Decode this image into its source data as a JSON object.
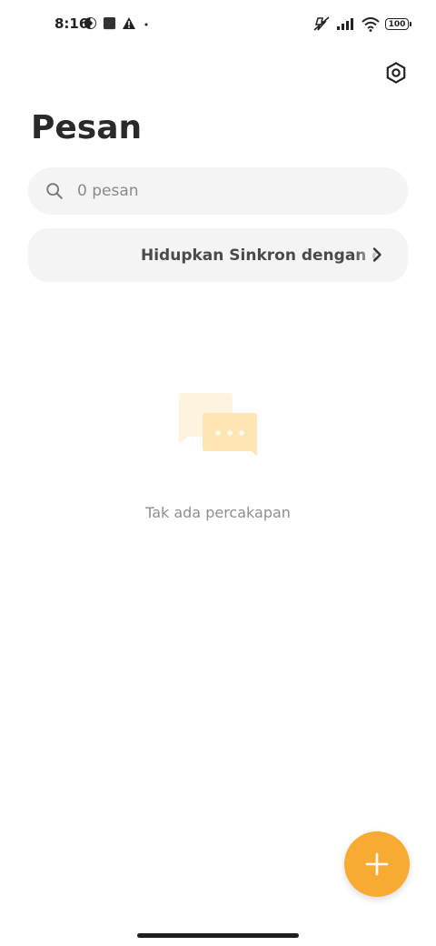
{
  "status_bar": {
    "time": "8:16",
    "battery": "100",
    "left_icons": [
      "vpn-icon",
      "app-square-icon",
      "warning-icon",
      "dot-icon"
    ],
    "right_icons": [
      "mute-icon",
      "signal-icon",
      "wifi-icon",
      "battery-icon"
    ]
  },
  "header": {
    "title": "Pesan",
    "settings_icon": "settings-hex-icon"
  },
  "search": {
    "placeholder": "0 pesan"
  },
  "sync_banner": {
    "label": "Hidupkan Sinkron dengan cloud"
  },
  "empty_state": {
    "message": "Tak ada percakapan",
    "icon": "chat-bubbles-icon"
  },
  "fab": {
    "icon": "plus-icon",
    "color": "#f8ab33"
  },
  "colors": {
    "accent": "#f8ab33",
    "surface": "#f4f4f4",
    "text_primary": "#2a2a2a",
    "text_muted": "#8e8e8e"
  }
}
